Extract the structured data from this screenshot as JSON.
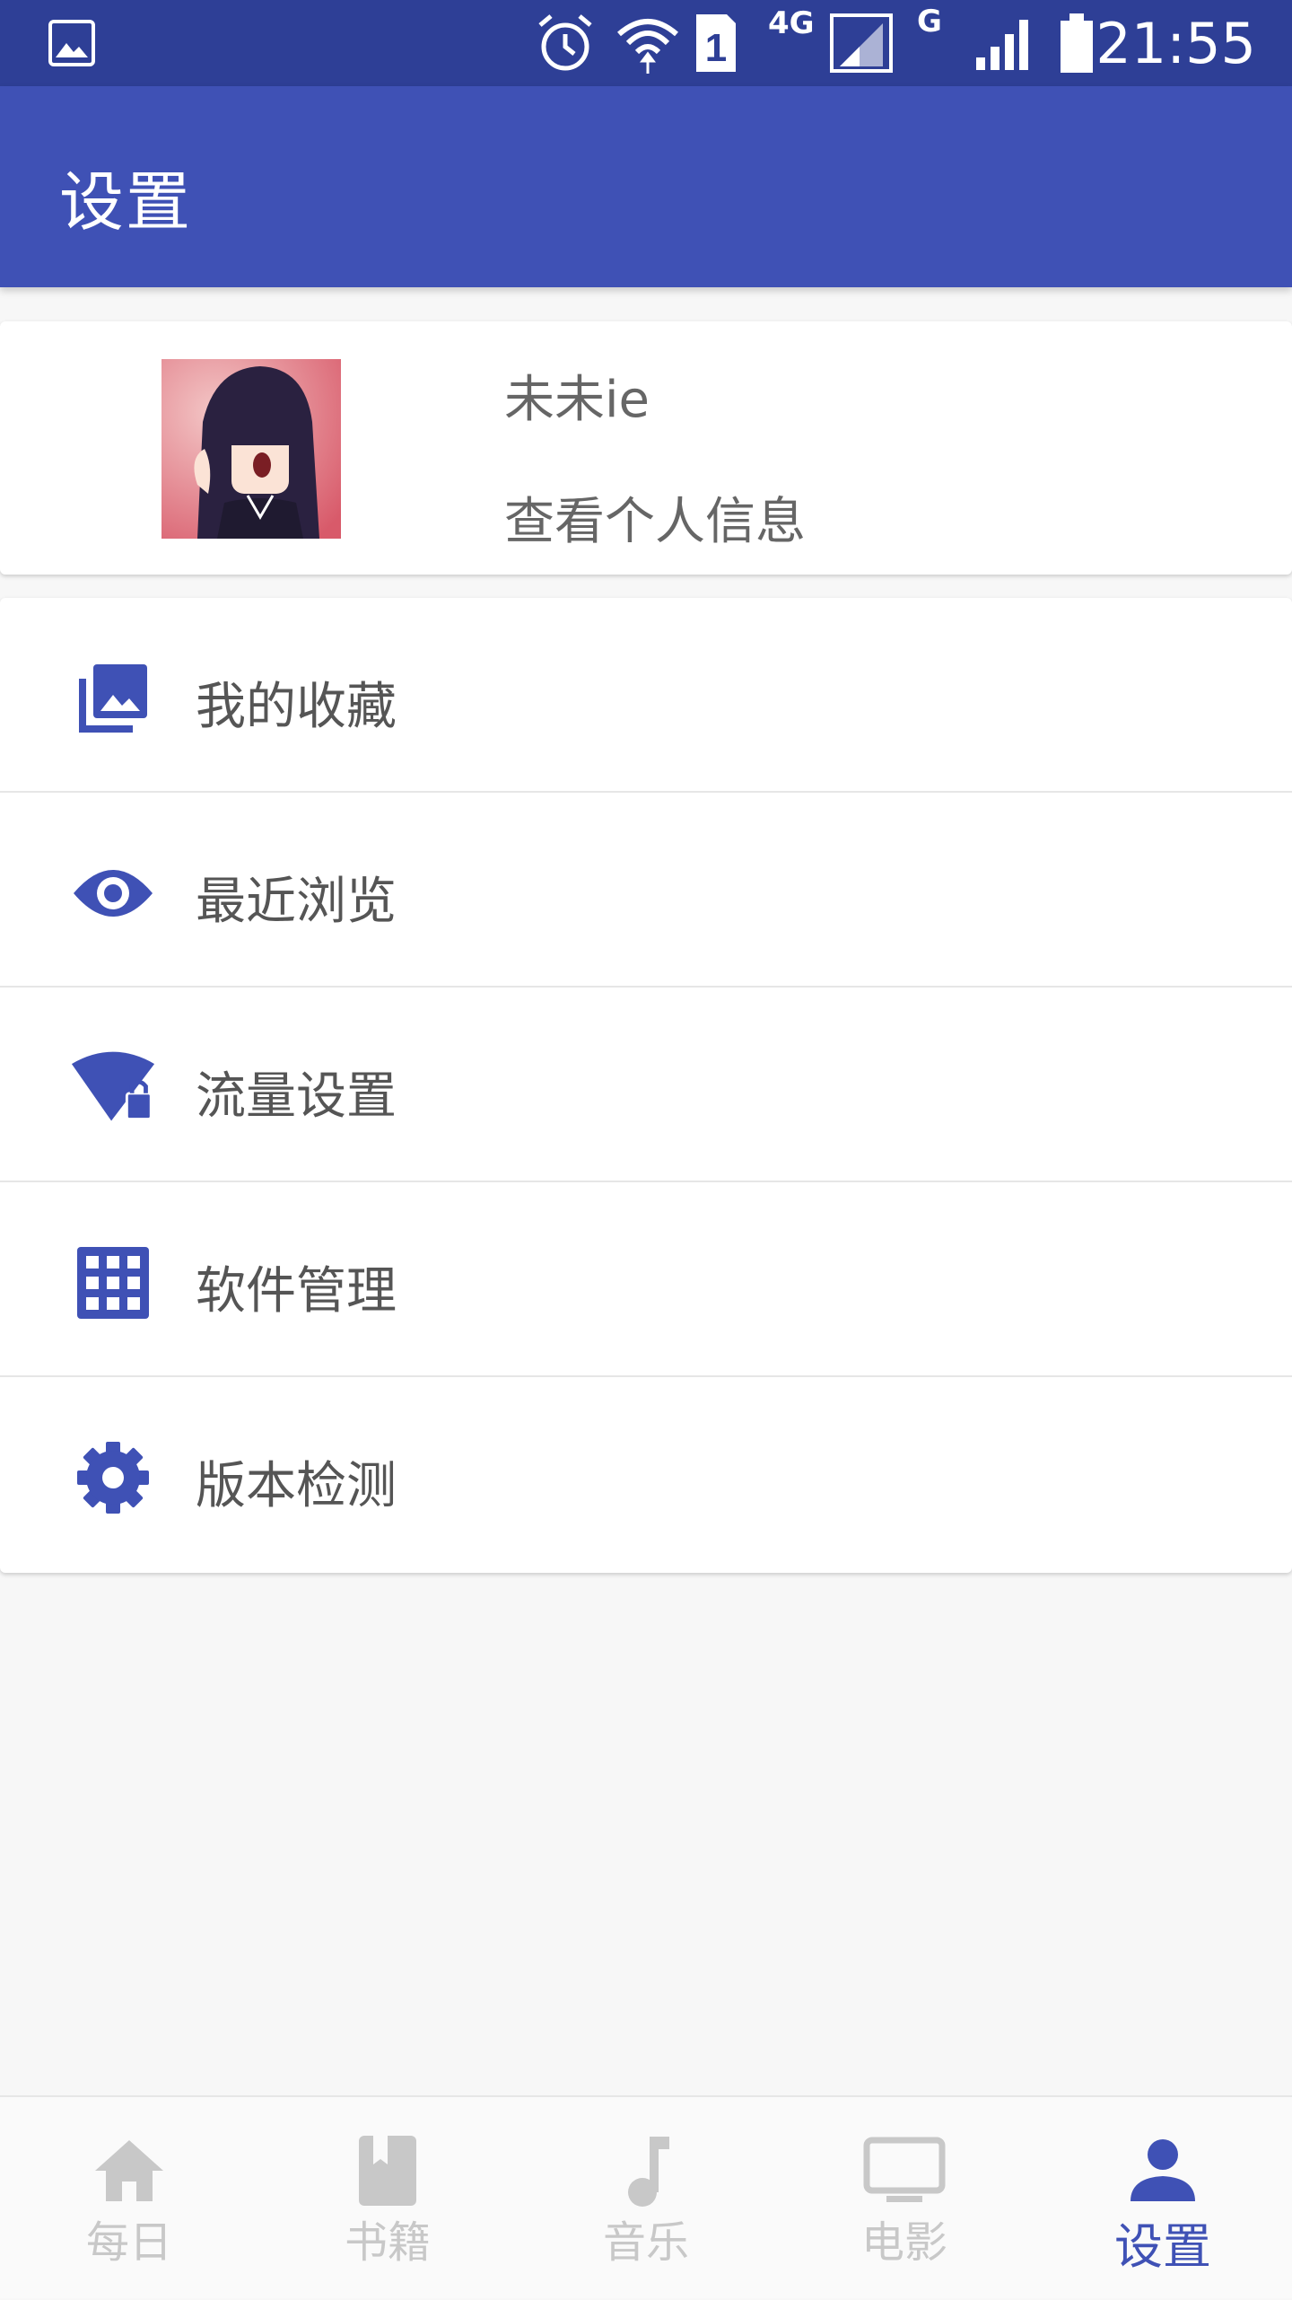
{
  "status_bar": {
    "time": "21:55",
    "network_4g": "4G",
    "network_g": "G",
    "sim_slot": "1",
    "icons": [
      "gallery-icon",
      "alarm-icon",
      "wifi-icon",
      "sim-1-icon",
      "signal-4g-icon",
      "signal-g-icon",
      "battery-icon"
    ]
  },
  "app_bar": {
    "title": "设置"
  },
  "profile": {
    "name": "未未ie",
    "subtitle": "查看个人信息",
    "avatar_icon": "avatar-image"
  },
  "menu": {
    "items": [
      {
        "label": "我的收藏",
        "icon": "photo-library-icon"
      },
      {
        "label": "最近浏览",
        "icon": "eye-icon"
      },
      {
        "label": "流量设置",
        "icon": "signal-lock-icon"
      },
      {
        "label": "软件管理",
        "icon": "grid-icon"
      },
      {
        "label": "版本检测",
        "icon": "gear-icon"
      }
    ]
  },
  "bottom_nav": {
    "items": [
      {
        "label": "每日",
        "icon": "home-icon",
        "active": false
      },
      {
        "label": "书籍",
        "icon": "book-icon",
        "active": false
      },
      {
        "label": "音乐",
        "icon": "music-note-icon",
        "active": false
      },
      {
        "label": "电影",
        "icon": "tv-icon",
        "active": false
      },
      {
        "label": "设置",
        "icon": "person-icon",
        "active": true
      }
    ]
  },
  "colors": {
    "primary": "#3f51b5",
    "status_bar": "#2e3f96",
    "inactive_nav": "#c8c8c8",
    "text": "#555555"
  }
}
